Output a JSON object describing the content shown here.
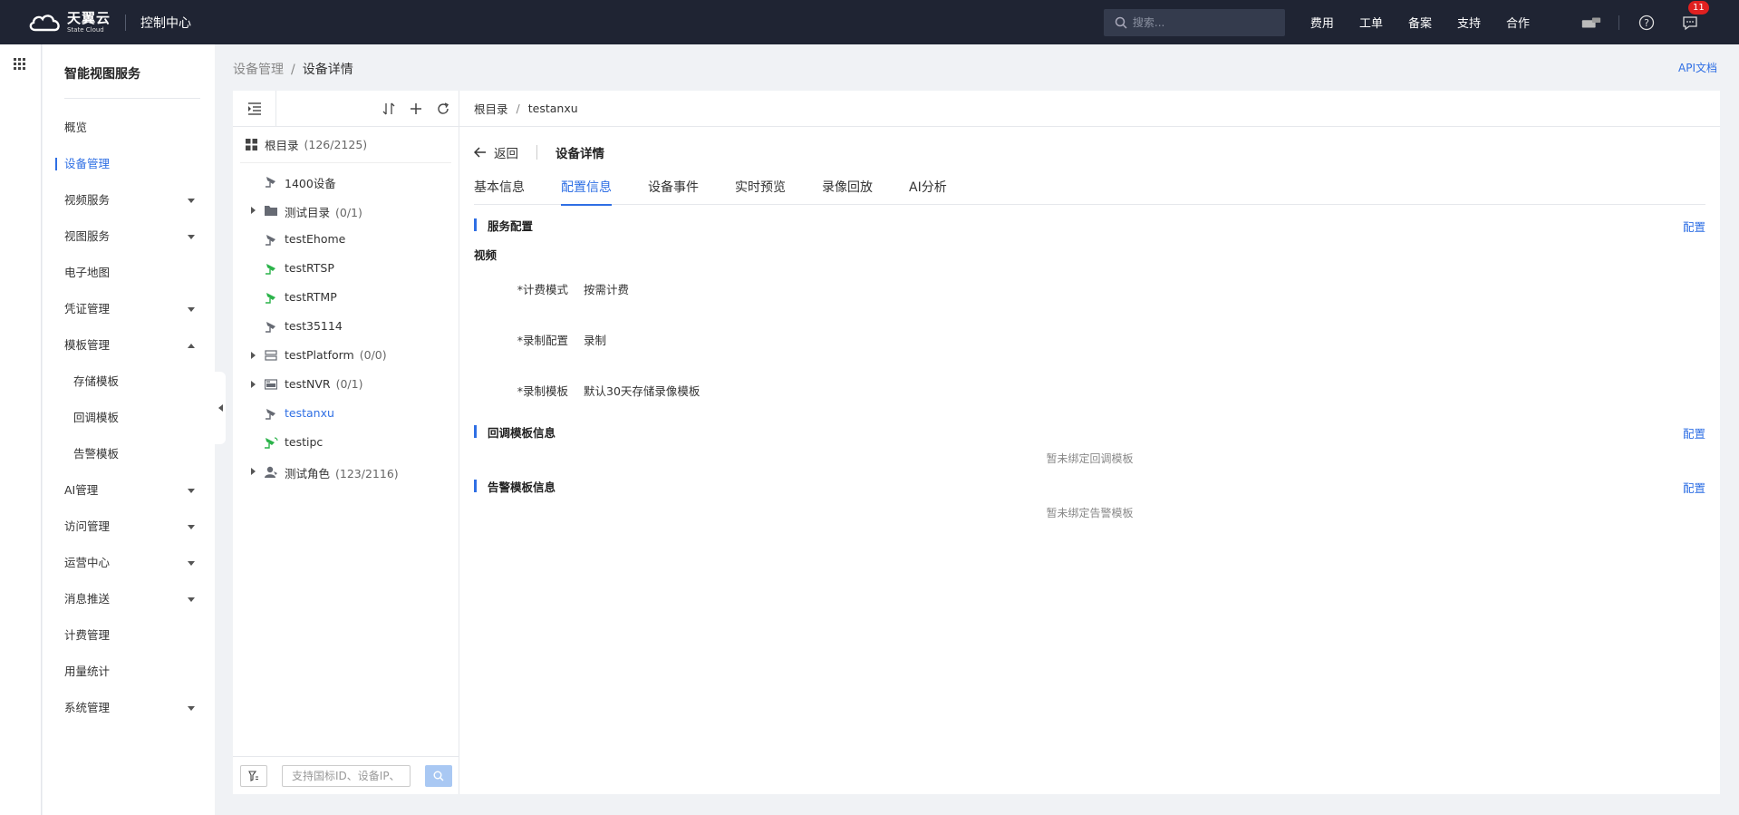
{
  "topbar": {
    "logo_cn": "天翼云",
    "logo_en": "State Cloud",
    "console_title": "控制中心",
    "search_placeholder": "搜索...",
    "nav": [
      "费用",
      "工单",
      "备案",
      "支持",
      "合作"
    ],
    "message_badge": "11"
  },
  "sidebar": {
    "title": "智能视图服务",
    "items": [
      {
        "label": "概览",
        "expandable": false
      },
      {
        "label": "设备管理",
        "expandable": false,
        "active": true
      },
      {
        "label": "视频服务",
        "expandable": true
      },
      {
        "label": "视图服务",
        "expandable": true
      },
      {
        "label": "电子地图",
        "expandable": false
      },
      {
        "label": "凭证管理",
        "expandable": true
      },
      {
        "label": "模板管理",
        "expandable": true,
        "expanded": true
      },
      {
        "label": "存储模板",
        "sub": true
      },
      {
        "label": "回调模板",
        "sub": true
      },
      {
        "label": "告警模板",
        "sub": true
      },
      {
        "label": "AI管理",
        "expandable": true
      },
      {
        "label": "访问管理",
        "expandable": true
      },
      {
        "label": "运营中心",
        "expandable": true
      },
      {
        "label": "消息推送",
        "expandable": true
      },
      {
        "label": "计费管理",
        "expandable": false
      },
      {
        "label": "用量统计",
        "expandable": false
      },
      {
        "label": "系统管理",
        "expandable": true
      }
    ]
  },
  "page": {
    "crumb_parent": "设备管理",
    "crumb_sep": "/",
    "crumb_current": "设备详情",
    "api_link": "API文档"
  },
  "tree": {
    "root_label": "根目录",
    "root_count": "(126/2125)",
    "nodes": [
      {
        "label": "1400设备",
        "count": "",
        "icon": "camera-gray",
        "expandable": false
      },
      {
        "label": "测试目录",
        "count": "(0/1)",
        "icon": "folder",
        "expandable": true
      },
      {
        "label": "testEhome",
        "count": "",
        "icon": "camera-gray",
        "expandable": false
      },
      {
        "label": "testRTSP",
        "count": "",
        "icon": "camera-green",
        "expandable": false
      },
      {
        "label": "testRTMP",
        "count": "",
        "icon": "camera-green",
        "expandable": false
      },
      {
        "label": "test35114",
        "count": "",
        "icon": "camera-gray",
        "expandable": false
      },
      {
        "label": "testPlatform",
        "count": "(0/0)",
        "icon": "platform",
        "expandable": true
      },
      {
        "label": "testNVR",
        "count": "(0/1)",
        "icon": "nvr",
        "expandable": true
      },
      {
        "label": "testanxu",
        "count": "",
        "icon": "camera-gray",
        "expandable": false,
        "selected": true
      },
      {
        "label": "testipc",
        "count": "",
        "icon": "camera-green-wifi",
        "expandable": false
      },
      {
        "label": "测试角色",
        "count": "(123/2116)",
        "icon": "role",
        "expandable": true
      }
    ],
    "search_placeholder": "支持国标ID、设备IP、"
  },
  "detail": {
    "crumb_root": "根目录",
    "crumb_sep": "/",
    "crumb_device": "testanxu",
    "back_label": "返回",
    "title": "设备详情",
    "tabs": [
      "基本信息",
      "配置信息",
      "设备事件",
      "实时预览",
      "录像回放",
      "AI分析"
    ],
    "active_tab": 1,
    "service_config": {
      "heading": "服务配置",
      "config_link": "配置",
      "video_subtitle": "视频",
      "fields": [
        {
          "label": "计费模式",
          "value": "按需计费"
        },
        {
          "label": "录制配置",
          "value": "录制"
        },
        {
          "label": "录制模板",
          "value": "默认30天存储录像模板"
        }
      ]
    },
    "callback": {
      "heading": "回调模板信息",
      "config_link": "配置",
      "empty": "暂未绑定回调模板"
    },
    "alarm": {
      "heading": "告警模板信息",
      "config_link": "配置",
      "empty": "暂未绑定告警模板"
    }
  },
  "colors": {
    "accent": "#2f6fe4",
    "topbar": "#1f2433",
    "online_green": "#2bb34a",
    "offline_gray": "#666a73"
  }
}
